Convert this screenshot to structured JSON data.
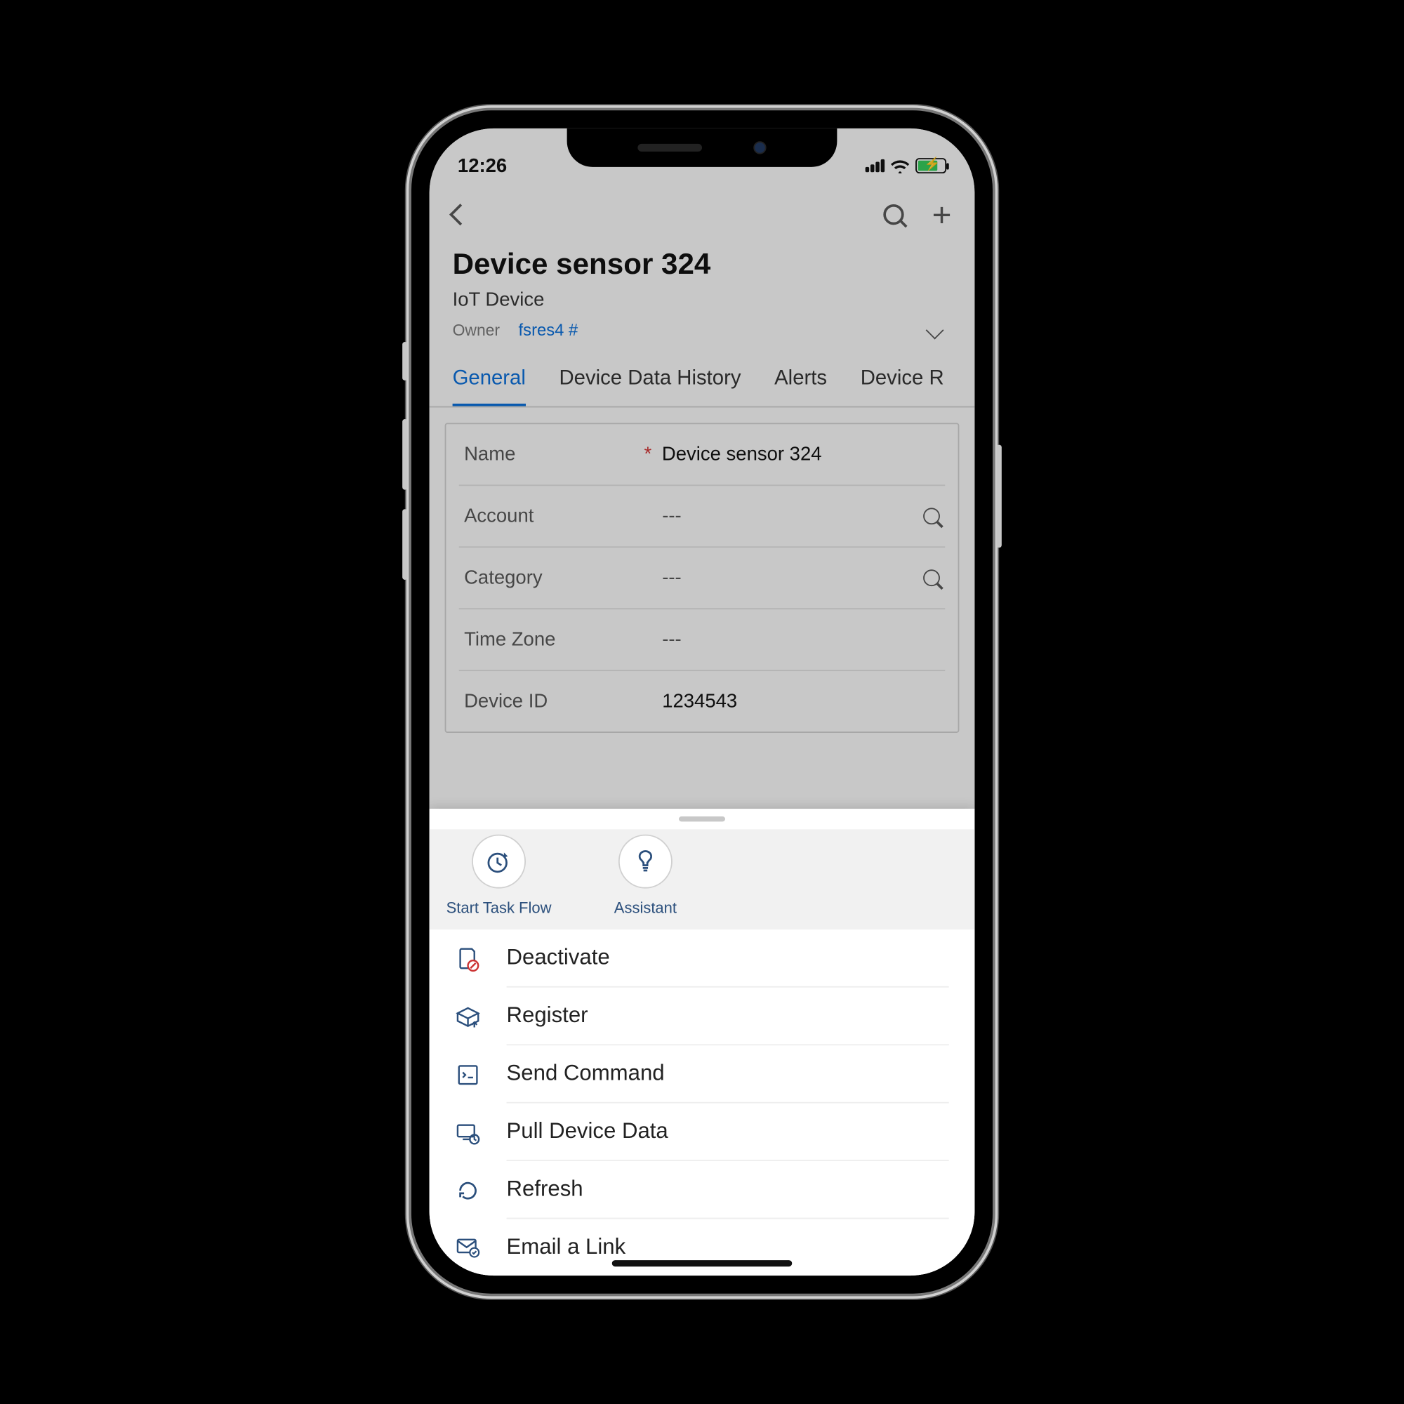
{
  "status": {
    "time": "12:26"
  },
  "header": {
    "title": "Device sensor 324",
    "subtitle": "IoT Device",
    "owner_label": "Owner",
    "owner_value": "fsres4 #"
  },
  "tabs": [
    "General",
    "Device Data History",
    "Alerts",
    "Device R"
  ],
  "active_tab": 0,
  "form": {
    "rows": [
      {
        "label": "Name",
        "value": "Device sensor 324",
        "required": true,
        "lookup": false
      },
      {
        "label": "Account",
        "value": "---",
        "required": false,
        "lookup": true
      },
      {
        "label": "Category",
        "value": "---",
        "required": false,
        "lookup": true
      },
      {
        "label": "Time Zone",
        "value": "---",
        "required": false,
        "lookup": false
      },
      {
        "label": "Device ID",
        "value": "1234543",
        "required": false,
        "lookup": false
      }
    ]
  },
  "sheet": {
    "top_buttons": [
      {
        "label": "Start Task Flow"
      },
      {
        "label": "Assistant"
      }
    ],
    "items": [
      {
        "label": "Deactivate",
        "icon": "deactivate"
      },
      {
        "label": "Register",
        "icon": "register"
      },
      {
        "label": "Send Command",
        "icon": "command"
      },
      {
        "label": "Pull Device Data",
        "icon": "pull"
      },
      {
        "label": "Refresh",
        "icon": "refresh"
      },
      {
        "label": "Email a Link",
        "icon": "email"
      }
    ]
  }
}
